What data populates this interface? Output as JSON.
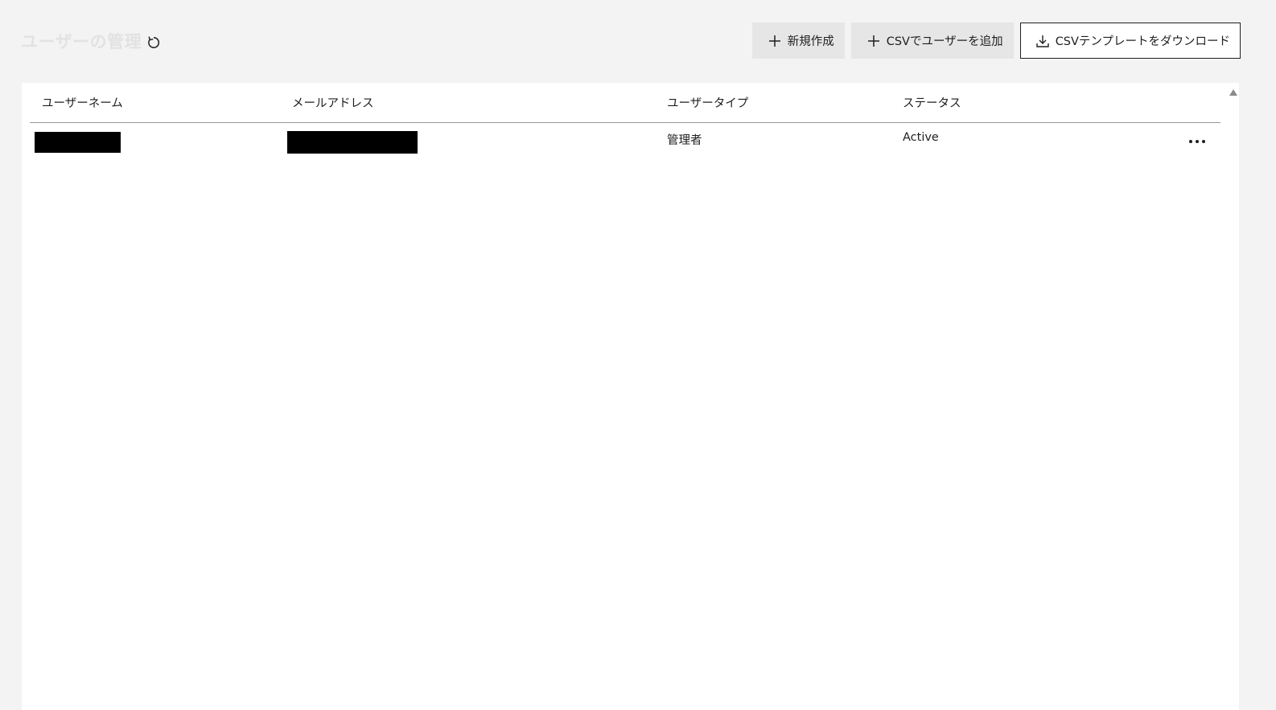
{
  "header": {
    "title": "ユーザーの管理"
  },
  "actions": {
    "new_label": "新規作成",
    "csv_add_label": "CSVでユーザーを追加",
    "csv_template_label": "CSVテンプレートをダウンロード"
  },
  "table": {
    "columns": [
      "ユーザーネーム",
      "メールアドレス",
      "ユーザータイプ",
      "ステータス"
    ],
    "rows": [
      {
        "user_type": "管理者",
        "status": "Active"
      }
    ]
  }
}
